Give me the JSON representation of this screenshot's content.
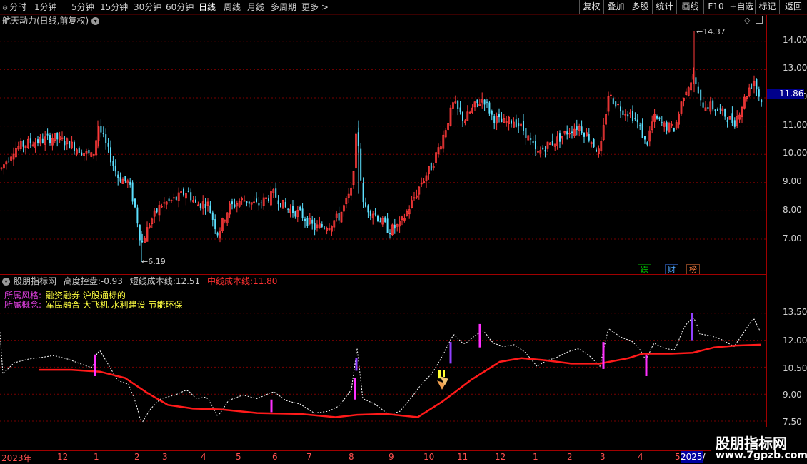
{
  "toolbar": {
    "periods": [
      "分时",
      "1分钟",
      "5分钟",
      "15分钟",
      "30分钟",
      "60分钟",
      "日线",
      "周线",
      "月线",
      "多周期",
      "更多 >"
    ],
    "active_period": "日线",
    "buttons": [
      "复权",
      "叠加",
      "多股",
      "统计",
      "画线",
      "F10",
      "+自选",
      "标记",
      "返回"
    ]
  },
  "main_chart": {
    "title": "航天动力(日线,前复权)",
    "price_labels": [
      "14.00",
      "13.00",
      "12.00",
      "11.00",
      "10.00",
      "9.00",
      "8.00",
      "7.00"
    ],
    "current_price": "11.86",
    "high_label": "14.37",
    "low_label": "6.19",
    "badges": [
      {
        "text": "跌",
        "color": "#00c000"
      },
      {
        "text": "财",
        "color": "#40a0ff"
      },
      {
        "text": "榜",
        "color": "#ff8040"
      }
    ]
  },
  "sub_chart": {
    "name": "股朋指标网",
    "label1": "高度控盘:",
    "value1": "-0.93",
    "label2": "短线成本线:",
    "value2": "12.51",
    "label3": "中线成本线:",
    "value3": "11.80",
    "tag_lines": [
      {
        "label": "所属风格:",
        "value": "融资融券 沪股通标的"
      },
      {
        "label": "所属概念:",
        "value": "军民融合 大飞机 水利建设 节能环保"
      }
    ],
    "axis_labels": [
      "13.50",
      "12.00",
      "10.50",
      "9.00",
      "7.50"
    ]
  },
  "date_axis": {
    "labels": [
      "2023年",
      "12",
      "1",
      "2",
      "3",
      "4",
      "5",
      "6",
      "7",
      "8",
      "9",
      "10",
      "11",
      "12",
      "1",
      "2",
      "3",
      "4",
      "5"
    ],
    "highlight": "2025/"
  },
  "watermark": {
    "title": "股朋指标网",
    "url": "www.7gpzb.com"
  },
  "colors": {
    "up_candle": "#ff3a3a",
    "down_candle": "#5ce0ff",
    "mid_cost_line": "#ff1a1a",
    "short_cost_line": "#ffffff",
    "grid": "#7a0000",
    "signal_magenta": "#ff30ff",
    "signal_purple": "#9040ff"
  }
}
